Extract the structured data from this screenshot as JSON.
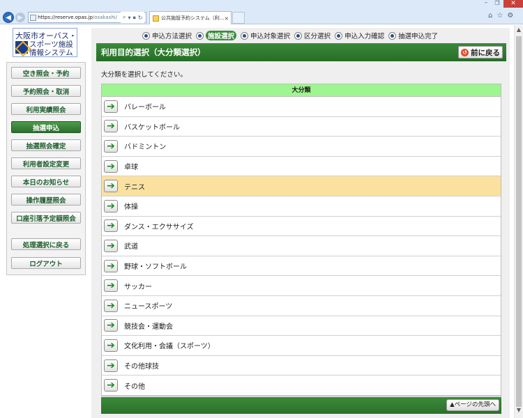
{
  "browser": {
    "url_domain": "https://reserve.opas.jp",
    "url_rest": "/osakashi/",
    "tab_title": "公共施設予約システム（利...",
    "tab_close": "×",
    "minimize": "–",
    "maximize": "❐",
    "close": "✕"
  },
  "logo": {
    "line1": "大阪市オーバス・",
    "line2": "スポーツ施設",
    "line3": "情報システム"
  },
  "sidebar": {
    "items": [
      {
        "label": "空き照会・予約",
        "active": false
      },
      {
        "label": "予約照会・取消",
        "active": false
      },
      {
        "label": "利用実績照会",
        "active": false
      },
      {
        "label": "抽選申込",
        "active": true
      },
      {
        "label": "抽選照会確定",
        "active": false
      },
      {
        "label": "利用者設定変更",
        "active": false
      },
      {
        "label": "本日のお知らせ",
        "active": false
      },
      {
        "label": "操作履歴照会",
        "active": false
      },
      {
        "label": "口座引落予定額照会",
        "active": false
      },
      {
        "label": "処理選択に戻る",
        "active": false
      },
      {
        "label": "ログアウト",
        "active": false
      }
    ]
  },
  "steps": [
    {
      "label": "申込方法選択",
      "current": false
    },
    {
      "label": "施設選択",
      "current": true
    },
    {
      "label": "申込対象選択",
      "current": false
    },
    {
      "label": "区分選択",
      "current": false
    },
    {
      "label": "申込入力確認",
      "current": false
    },
    {
      "label": "抽選申込完了",
      "current": false
    }
  ],
  "header": {
    "title": "利用目的選択（大分類選択）",
    "back_label": "前に戻る"
  },
  "instruction": "大分類を選択してください。",
  "table": {
    "header": "大分類",
    "rows": [
      {
        "label": "バレーボール",
        "highlight": false
      },
      {
        "label": "バスケットボール",
        "highlight": false
      },
      {
        "label": "バドミントン",
        "highlight": false
      },
      {
        "label": "卓球",
        "highlight": false
      },
      {
        "label": "テニス",
        "highlight": true
      },
      {
        "label": "体操",
        "highlight": false
      },
      {
        "label": "ダンス・エクササイズ",
        "highlight": false
      },
      {
        "label": "武道",
        "highlight": false
      },
      {
        "label": "野球・ソフトボール",
        "highlight": false
      },
      {
        "label": "サッカー",
        "highlight": false
      },
      {
        "label": "ニュースポーツ",
        "highlight": false
      },
      {
        "label": "競技会・運動会",
        "highlight": false
      },
      {
        "label": "文化利用・会議（スポーツ）",
        "highlight": false
      },
      {
        "label": "その他球技",
        "highlight": false
      },
      {
        "label": "その他",
        "highlight": false
      }
    ]
  },
  "footer": {
    "top_link": "▲ページの先頭へ"
  },
  "colors": {
    "accent_green": "#2d7a2d",
    "header_green": "#9ff58f",
    "highlight_row": "#fbe1a0"
  }
}
